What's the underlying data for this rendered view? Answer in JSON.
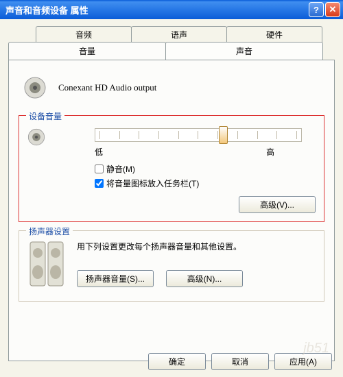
{
  "titlebar": {
    "title": "声音和音频设备  属性"
  },
  "tabs": {
    "row2": [
      "音频",
      "语声",
      "硬件"
    ],
    "row1": [
      "音量",
      "声音"
    ],
    "active": "音量"
  },
  "device": {
    "name": "Conexant HD Audio output"
  },
  "device_volume": {
    "legend": "设备音量",
    "low": "低",
    "high": "高",
    "position_pct": 62,
    "mute": {
      "label": "静音(M)",
      "checked": false
    },
    "tray": {
      "label": "将音量图标放入任务栏(T)",
      "checked": true
    },
    "advanced": "高级(V)..."
  },
  "speaker_settings": {
    "legend": "扬声器设置",
    "desc": "用下列设置更改每个扬声器音量和其他设置。",
    "volume_btn": "扬声器音量(S)...",
    "advanced_btn": "高级(N)..."
  },
  "dialog_buttons": {
    "ok": "确定",
    "cancel": "取消",
    "apply": "应用(A)"
  }
}
